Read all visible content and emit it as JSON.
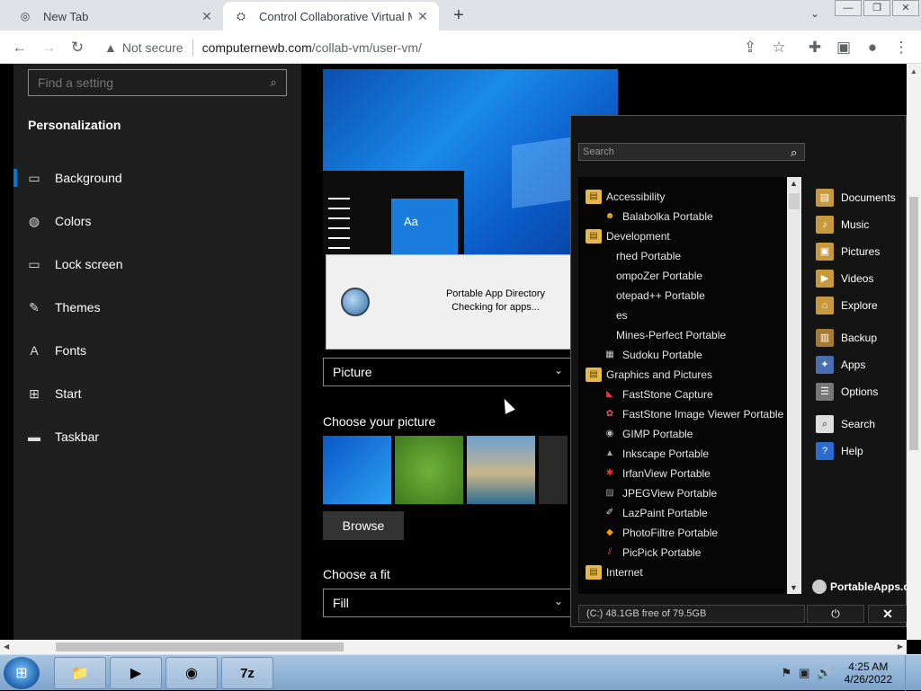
{
  "browser": {
    "tabs": [
      {
        "title": "New Tab",
        "icon": "new-tab-icon"
      },
      {
        "title": "Control Collaborative Virtual Ma",
        "icon": "collabvm-icon"
      }
    ],
    "address": {
      "security": "Not secure",
      "host": "computernewb.com",
      "path": "/collab-vm/user-vm/"
    }
  },
  "settings": {
    "search_placeholder": "Find a setting",
    "section": "Personalization",
    "nav": [
      {
        "label": "Background",
        "icon": "picture-icon"
      },
      {
        "label": "Colors",
        "icon": "palette-icon"
      },
      {
        "label": "Lock screen",
        "icon": "lock-screen-icon"
      },
      {
        "label": "Themes",
        "icon": "brush-icon"
      },
      {
        "label": "Fonts",
        "icon": "font-icon"
      },
      {
        "label": "Start",
        "icon": "start-icon"
      },
      {
        "label": "Taskbar",
        "icon": "taskbar-icon"
      }
    ],
    "preview_tile": "Aa",
    "background_value": "Picture",
    "choose_picture": "Choose your picture",
    "browse": "Browse",
    "choose_fit": "Choose a fit",
    "fit_value": "Fill"
  },
  "dialog": {
    "line1": "Portable App Directory",
    "line2": "Checking for apps..."
  },
  "portableapps": {
    "search_placeholder": "Search",
    "list": [
      {
        "label": "Accessibility",
        "kind": "cat"
      },
      {
        "label": "Balabolka Portable",
        "kind": "app"
      },
      {
        "label": "Development",
        "kind": "cat"
      },
      {
        "label": "rhed Portable",
        "kind": "app"
      },
      {
        "label": "ompoZer Portable",
        "kind": "app"
      },
      {
        "label": "otepad++ Portable",
        "kind": "app"
      },
      {
        "label": "es",
        "kind": "app"
      },
      {
        "label": "Mines-Perfect Portable",
        "kind": "app"
      },
      {
        "label": "Sudoku Portable",
        "kind": "app"
      },
      {
        "label": "Graphics and Pictures",
        "kind": "cat"
      },
      {
        "label": "FastStone Capture",
        "kind": "app"
      },
      {
        "label": "FastStone Image Viewer Portable",
        "kind": "app"
      },
      {
        "label": "GIMP Portable",
        "kind": "app"
      },
      {
        "label": "Inkscape Portable",
        "kind": "app"
      },
      {
        "label": "IrfanView Portable",
        "kind": "app"
      },
      {
        "label": "JPEGView Portable",
        "kind": "app"
      },
      {
        "label": "LazPaint Portable",
        "kind": "app"
      },
      {
        "label": "PhotoFiltre Portable",
        "kind": "app"
      },
      {
        "label": "PicPick Portable",
        "kind": "app"
      },
      {
        "label": "Internet",
        "kind": "cat"
      }
    ],
    "right": [
      {
        "label": "Documents",
        "icon": "folder-icon"
      },
      {
        "label": "Music",
        "icon": "music-folder-icon"
      },
      {
        "label": "Pictures",
        "icon": "pictures-folder-icon"
      },
      {
        "label": "Videos",
        "icon": "videos-folder-icon"
      },
      {
        "label": "Explore",
        "icon": "home-folder-icon"
      },
      {
        "label": "Backup",
        "icon": "backup-icon"
      },
      {
        "label": "Apps",
        "icon": "apps-icon"
      },
      {
        "label": "Options",
        "icon": "options-icon"
      },
      {
        "label": "Search",
        "icon": "search-icon"
      },
      {
        "label": "Help",
        "icon": "help-icon"
      }
    ],
    "brand": "PortableApps.c",
    "status": "(C:) 48.1GB free of 79.5GB"
  },
  "taskbar": {
    "apps": [
      "explorer-icon",
      "media-player-icon",
      "chrome-icon",
      "7zip-icon"
    ],
    "time": "4:25 AM",
    "date": "4/26/2022",
    "app_7z": "7z"
  }
}
